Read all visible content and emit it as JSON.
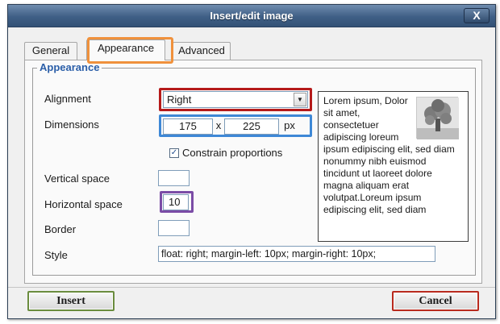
{
  "window": {
    "title": "Insert/edit image",
    "close_label": "X"
  },
  "tabs": [
    {
      "label": "General",
      "active": false
    },
    {
      "label": "Appearance",
      "active": true
    },
    {
      "label": "Advanced",
      "active": false
    }
  ],
  "appearance": {
    "legend": "Appearance",
    "alignment": {
      "label": "Alignment",
      "value": "Right"
    },
    "dimensions": {
      "label": "Dimensions",
      "width": "175",
      "separator": "x",
      "height": "225",
      "unit": "px"
    },
    "constrain": {
      "label": "Constrain proportions",
      "checked": true,
      "check_glyph": "✓"
    },
    "vertical_space": {
      "label": "Vertical space",
      "value": ""
    },
    "horizontal_space": {
      "label": "Horizontal space",
      "value": "10"
    },
    "border": {
      "label": "Border",
      "value": ""
    },
    "style": {
      "label": "Style",
      "value": "float: right; margin-left: 10px; margin-right: 10px;"
    }
  },
  "preview": {
    "text": "Lorem ipsum, Dolor sit amet, consectetuer adipiscing loreum ipsum edipiscing elit, sed diam nonummy nibh euismod tincidunt ut laoreet dolore magna aliquam erat volutpat.Loreum ipsum edipiscing elit, sed diam",
    "image_icon": "tree-thumbnail-icon"
  },
  "buttons": {
    "insert": "Insert",
    "cancel": "Cancel"
  },
  "colors": {
    "highlight_tab": "#f0913c",
    "highlight_alignment": "#b51a1a",
    "highlight_dimensions": "#3e88d6",
    "highlight_hspace": "#7b4ca6",
    "legend_text": "#2a5ea8"
  }
}
